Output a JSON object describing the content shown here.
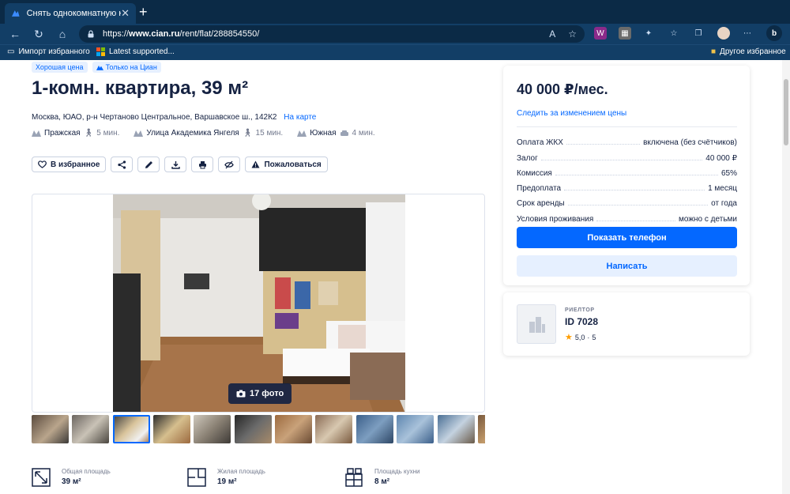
{
  "browser": {
    "tab_title": "Снять однокомнатную кварти",
    "url_prefix": "https://",
    "url_host": "www.cian.ru",
    "url_path": "/rent/flat/288854550/",
    "bookmarks": {
      "import": "Импорт избранного",
      "latest": "Latest supported...",
      "other": "Другое избранное"
    }
  },
  "listing": {
    "badges": {
      "good_price": "Хорошая цена",
      "only_cian": "Только на Циан"
    },
    "title": "1-комн. квартира, 39 м²",
    "address": "Москва, ЮАО, р-н Чертаново Центральное, Варшавское ш., 142К2",
    "map_link": "На карте",
    "metro": [
      {
        "station": "Пражская",
        "time": "5 мин."
      },
      {
        "station": "Улица Академика Янгеля",
        "time": "15 мин."
      },
      {
        "station": "Южная",
        "time": "4 мин."
      }
    ],
    "actions": {
      "favorite": "В избранное",
      "report": "Пожаловаться"
    },
    "photo_count": "17 фото",
    "features": [
      {
        "label": "Общая площадь",
        "value": "39 м²"
      },
      {
        "label": "Жилая площадь",
        "value": "19 м²"
      },
      {
        "label": "Площадь кухни",
        "value": "8 м²"
      }
    ]
  },
  "price_card": {
    "price": "40 000 ₽/мес.",
    "track": "Следить за изменением цены",
    "rows": [
      {
        "label": "Оплата ЖКХ",
        "value": "включена (без счётчиков)"
      },
      {
        "label": "Залог",
        "value": "40 000 ₽"
      },
      {
        "label": "Комиссия",
        "value": "65%"
      },
      {
        "label": "Предоплата",
        "value": "1 месяц"
      },
      {
        "label": "Срок аренды",
        "value": "от года"
      },
      {
        "label": "Условия проживания",
        "value": "можно с детьми"
      }
    ],
    "show_phone": "Показать телефон",
    "write": "Написать"
  },
  "agent": {
    "role": "РИЕЛТОР",
    "id": "ID 7028",
    "rating": "5,0",
    "reviews": "5"
  },
  "colors": {
    "brand_blue": "#0468ff",
    "text_dark": "#152242",
    "chrome_dark": "#0b2a46",
    "chrome": "#123e66"
  }
}
